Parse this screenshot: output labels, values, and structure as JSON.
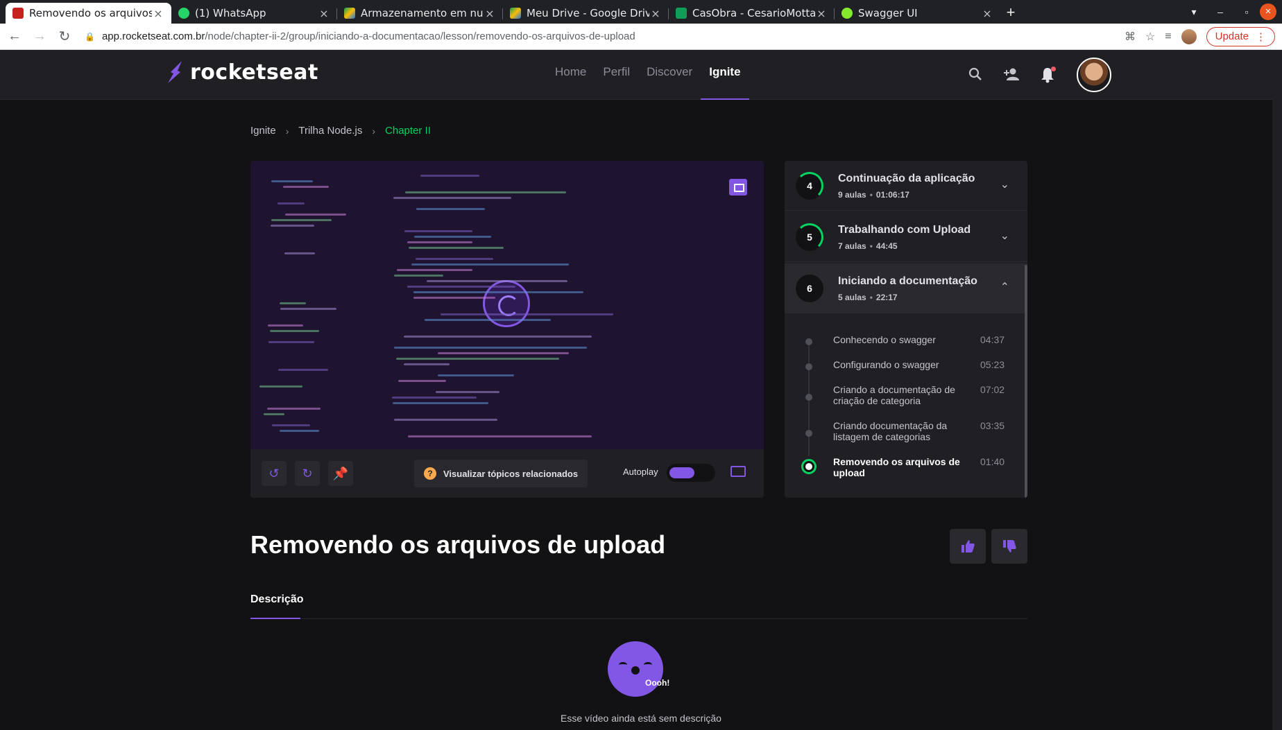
{
  "browser": {
    "tabs": [
      {
        "title": "Removendo os arquivos d",
        "favicon_color": "#c5221f",
        "active": true
      },
      {
        "title": "(1) WhatsApp",
        "favicon_color": "#25d366"
      },
      {
        "title": "Armazenamento em nuve",
        "favicon_color": "#fbbc04"
      },
      {
        "title": "Meu Drive - Google Drive",
        "favicon_color": "#1a73e8"
      },
      {
        "title": "CasObra - CesarioMotta.x",
        "favicon_color": "#0f9d58"
      },
      {
        "title": "Swagger UI",
        "favicon_color": "#85ea2d"
      }
    ],
    "url_host": "app.rocketseat.com.br",
    "url_path": "/node/chapter-ii-2/group/iniciando-a-documentacao/lesson/removendo-os-arquivos-de-upload",
    "update_label": "Update"
  },
  "header": {
    "logo": "rocketseat",
    "nav": [
      {
        "label": "Home"
      },
      {
        "label": "Perfil"
      },
      {
        "label": "Discover"
      },
      {
        "label": "Ignite",
        "active": true
      }
    ]
  },
  "breadcrumb": [
    "Ignite",
    "Trilha Node.js",
    "Chapter II"
  ],
  "player": {
    "related_topics": "Visualizar tópicos relacionados",
    "autoplay_label": "Autoplay",
    "autoplay_on": true
  },
  "course": {
    "modules": [
      {
        "number": "4",
        "title": "Continuação da aplicação",
        "lessons": "9 aulas",
        "duration": "01:06:17"
      },
      {
        "number": "5",
        "title": "Trabalhando com Upload",
        "lessons": "7 aulas",
        "duration": "44:45"
      },
      {
        "number": "6",
        "title": "Iniciando a documentação",
        "lessons": "5 aulas",
        "duration": "22:17",
        "open": true
      }
    ],
    "lessons": [
      {
        "title": "Conhecendo o swagger",
        "duration": "04:37"
      },
      {
        "title": "Configurando o swagger",
        "duration": "05:23"
      },
      {
        "title": "Criando a documentação de criação de categoria",
        "duration": "07:02"
      },
      {
        "title": "Criando documentação da listagem de categorias",
        "duration": "03:35"
      },
      {
        "title": "Removendo os arquivos de upload",
        "duration": "01:40",
        "current": true
      }
    ]
  },
  "lesson": {
    "title": "Removendo os arquivos de upload",
    "tab_description": "Descrição",
    "mascot_text": "Oooh!",
    "empty_description": "Esse vídeo ainda está sem descrição"
  },
  "colors": {
    "accent": "#8257e5",
    "success": "#04d361",
    "background": "#121214"
  }
}
